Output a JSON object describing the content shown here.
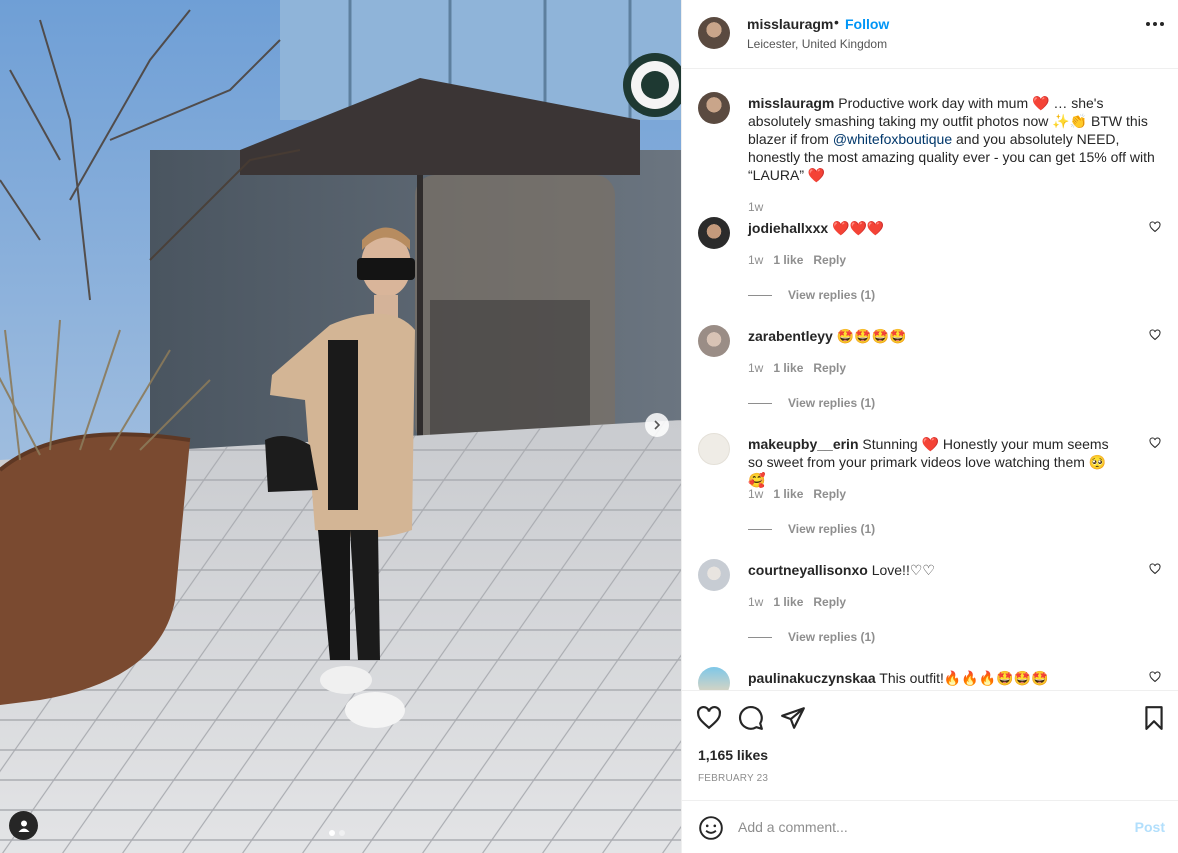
{
  "colors": {
    "accent": "#0095f6",
    "muted": "#8e8e8e",
    "heart": "#e0245e"
  },
  "header": {
    "username": "misslauragm",
    "separator": "•",
    "follow_label": "Follow",
    "location": "Leicester, United Kingdom",
    "more_icon": "more-options-icon"
  },
  "caption": {
    "username": "misslauragm",
    "part1": "Productive work day with mum",
    "part2": " … she's absolutely smashing taking my outfit photos now",
    "part3": " BTW this blazer if from ",
    "mention": "@whitefoxboutique",
    "part4": " and you absolutely NEED, honestly the most amazing quality ever - you can get 15% off with “LAURA”",
    "time": "1w"
  },
  "comments": [
    {
      "username": "jodiehallxxx",
      "text": "❤️❤️❤️",
      "time": "1w",
      "likes": "1 like",
      "reply": "Reply",
      "view_replies": "View replies (1)"
    },
    {
      "username": "zarabentleyy",
      "text": "🤩🤩🤩🤩",
      "time": "1w",
      "likes": "1 like",
      "reply": "Reply",
      "view_replies": "View replies (1)"
    },
    {
      "username": "makeupby__erin",
      "text": "Stunning ❤️ Honestly your mum seems so sweet from your primark videos love watching them 🥺🥰",
      "time": "1w",
      "likes": "1 like",
      "reply": "Reply",
      "view_replies": "View replies (1)"
    },
    {
      "username": "courtneyallisonxo",
      "text": "Love!!♡♡",
      "time": "1w",
      "likes": "1 like",
      "reply": "Reply",
      "view_replies": "View replies (1)"
    },
    {
      "username": "paulinakuczynskaa",
      "text": "This outfit!🔥🔥🔥🤩🤩🤩"
    }
  ],
  "actions": {
    "icons": [
      "heart-icon",
      "comment-icon",
      "share-icon",
      "bookmark-icon"
    ],
    "likes_text": "1,165 likes",
    "date": "FEBRUARY 23"
  },
  "composer": {
    "placeholder": "Add a comment...",
    "post_label": "Post",
    "emoji_icon": "emoji-icon"
  },
  "carousel": {
    "current": 1,
    "total": 2
  }
}
